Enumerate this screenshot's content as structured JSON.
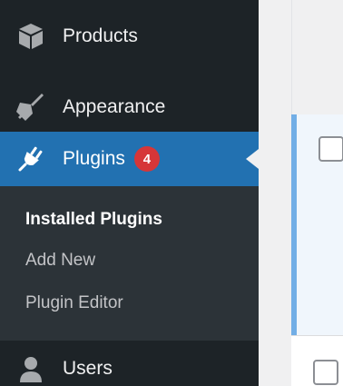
{
  "sidebar": {
    "items": [
      {
        "label": "Products",
        "icon": "box-icon"
      },
      {
        "label": "Appearance",
        "icon": "paintbrush-icon"
      },
      {
        "label": "Plugins",
        "icon": "plugin-icon",
        "badge": "4"
      },
      {
        "label": "Users",
        "icon": "user-icon"
      }
    ],
    "submenu": [
      {
        "label": "Installed Plugins"
      },
      {
        "label": "Add New"
      },
      {
        "label": "Plugin Editor"
      }
    ]
  },
  "colors": {
    "sidebar_bg": "#1d2327",
    "submenu_bg": "#2c3338",
    "active_bg": "#2271b1",
    "badge_bg": "#d63638",
    "row_highlight_border": "#72aee6"
  }
}
